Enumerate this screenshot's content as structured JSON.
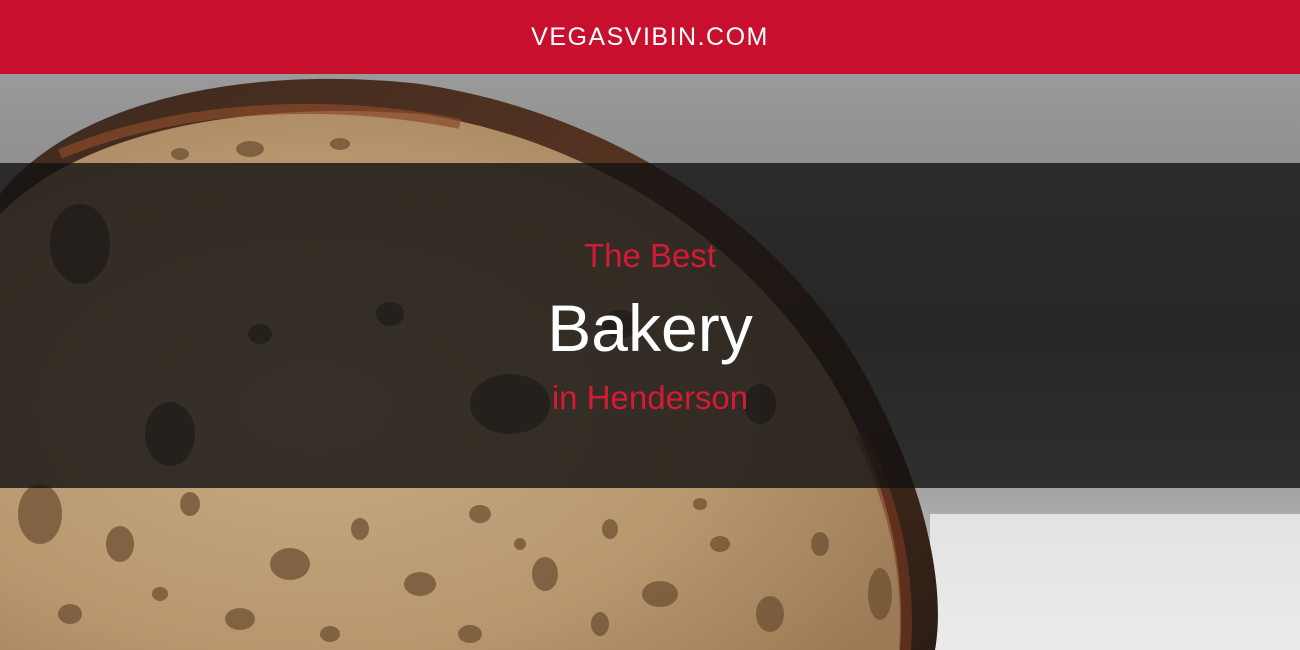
{
  "header": {
    "site_name": "VEGASVIBIN.COM",
    "background_color": "#c8102e"
  },
  "hero": {
    "image": "bread-loaf-photo",
    "title_pre": "The Best",
    "title_main": "Bakery",
    "title_post": "in Henderson",
    "accent_color": "#d61a36",
    "main_color": "#ffffff"
  }
}
